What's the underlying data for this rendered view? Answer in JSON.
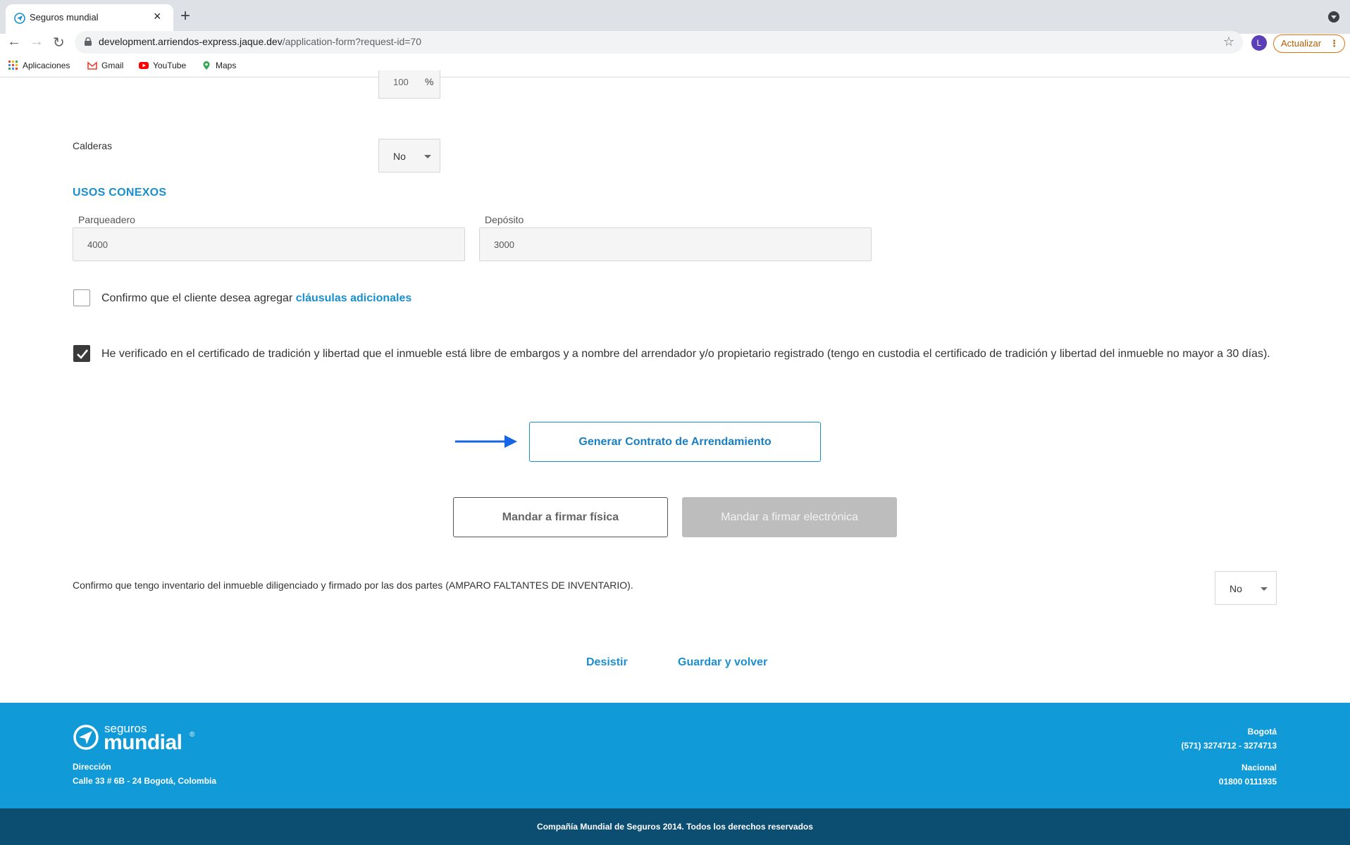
{
  "browser": {
    "tab_title": "Seguros mundial",
    "url_host": "development.arriendos-express.jaque.dev",
    "url_path": "/application-form?request-id=70",
    "avatar_letter": "L",
    "update_label": "Actualizar",
    "bookmarks": [
      {
        "label": "Aplicaciones",
        "icon": "apps-grid-icon"
      },
      {
        "label": "Gmail",
        "icon": "gmail-icon"
      },
      {
        "label": "YouTube",
        "icon": "youtube-icon"
      },
      {
        "label": "Maps",
        "icon": "maps-icon"
      }
    ]
  },
  "form": {
    "percent_value": "100",
    "percent_unit": "%",
    "calderas_label": "Calderas",
    "calderas_value": "No",
    "usos_title": "USOS CONEXOS",
    "parqueadero_label": "Parqueadero",
    "parqueadero_value": "4000",
    "deposito_label": "Depósito",
    "deposito_value": "3000",
    "clausulas_text": "Confirmo que el cliente desea agregar",
    "clausulas_link": "cláusulas adicionales",
    "clausulas_checked": false,
    "verificado_text": "He verificado en el certificado de tradición y libertad que el inmueble está libre de embargos y a nombre del arrendador y/o propietario registrado (tengo en custodia el certificado de tradición y libertad del inmueble no mayor a 30 días).",
    "verificado_checked": true,
    "generate_label": "Generar Contrato de Arrendamiento",
    "firmar_fisica_label": "Mandar a firmar física",
    "firmar_electronica_label": "Mandar a firmar electrónica",
    "inventario_text": "Confirmo que tengo inventario del inmueble diligenciado y firmado por las dos partes (AMPARO FALTANTES DE INVENTARIO).",
    "inventario_value": "No",
    "desistir_label": "Desistir",
    "guardar_label": "Guardar y volver"
  },
  "footer": {
    "logo_top": "seguros",
    "logo_main": "mundial",
    "logo_reg": "®",
    "direccion_label": "Dirección",
    "direccion_value": "Calle 33 # 6B - 24 Bogotá, Colombia",
    "bogota_label": "Bogotá",
    "bogota_phone": "(571) 3274712 - 3274713",
    "nacional_label": "Nacional",
    "nacional_phone": "01800 0111935",
    "copyright": "Compañía Mundial de Seguros 2014. Todos los derechos reservados"
  },
  "colors": {
    "accent": "#1a8fcf",
    "footer_bg": "#119ad8",
    "footer_bottom_bg": "#0c4d72",
    "arrow": "#1565e6"
  }
}
